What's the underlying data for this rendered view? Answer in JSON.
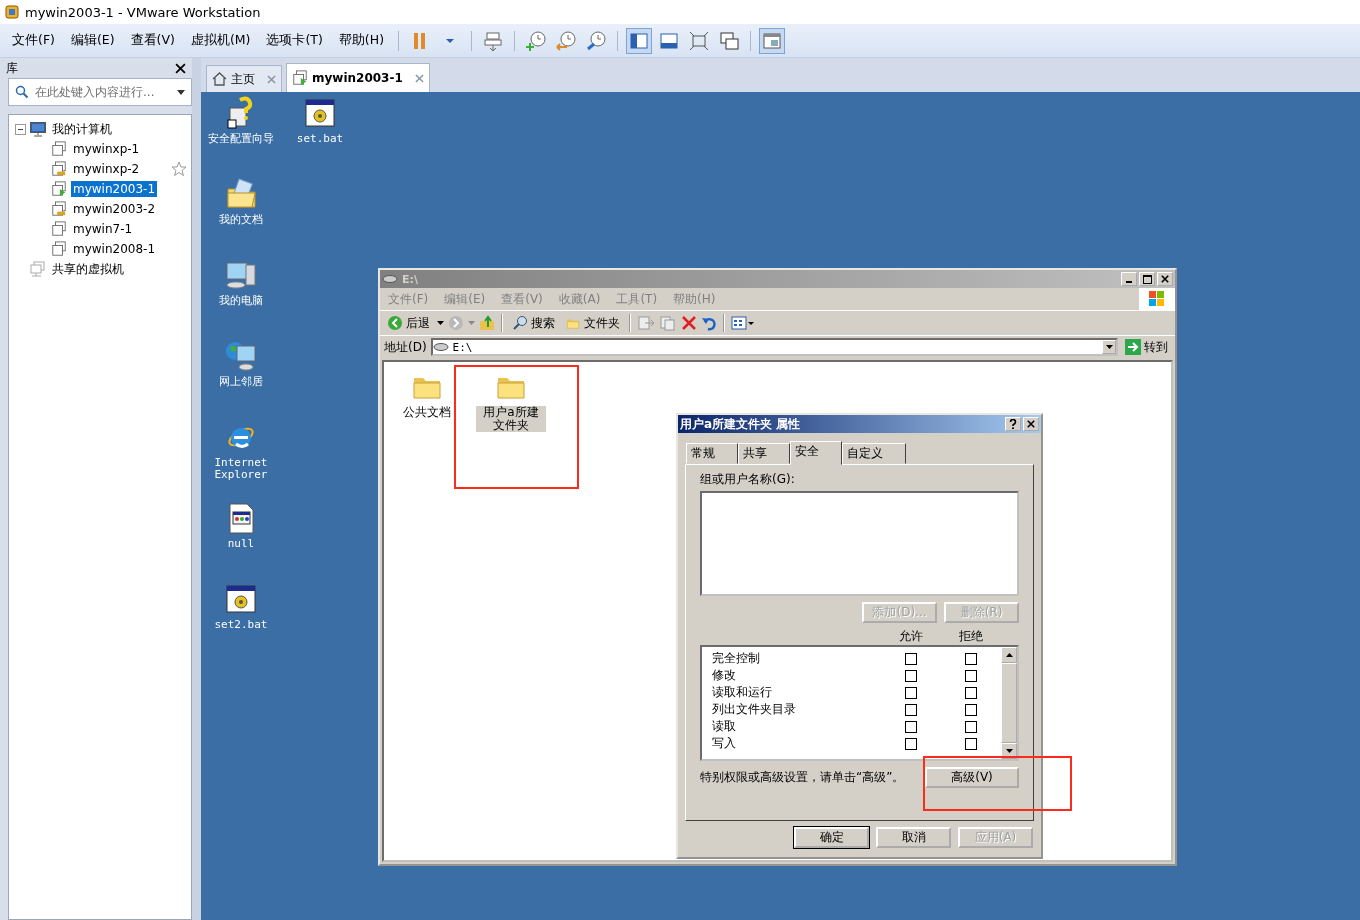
{
  "window": {
    "title": "mywin2003-1 - VMware Workstation"
  },
  "menu": [
    "文件(F)",
    "编辑(E)",
    "查看(V)",
    "虚拟机(M)",
    "选项卡(T)",
    "帮助(H)"
  ],
  "library": {
    "title": "库",
    "search": {
      "placeholder": "在此处键入内容进行..."
    },
    "tree": [
      {
        "label": "我的计算机",
        "kind": "computer",
        "expanded": true,
        "children": [
          {
            "label": "mywinxp-1",
            "kind": "off",
            "selected": false,
            "hovered": false
          },
          {
            "label": "mywinxp-2",
            "kind": "suspended",
            "selected": false,
            "hovered": true
          },
          {
            "label": "mywin2003-1",
            "kind": "running",
            "selected": true,
            "hovered": false
          },
          {
            "label": "mywin2003-2",
            "kind": "suspended",
            "selected": false,
            "hovered": false
          },
          {
            "label": "mywin7-1",
            "kind": "off",
            "selected": false,
            "hovered": false
          },
          {
            "label": "mywin2008-1",
            "kind": "off",
            "selected": false,
            "hovered": false
          }
        ]
      },
      {
        "label": "共享的虚拟机",
        "kind": "shared",
        "expanded": false
      }
    ]
  },
  "tabs": [
    {
      "label": "主页",
      "kind": "home",
      "selected": false
    },
    {
      "label": "mywin2003-1",
      "kind": "vm",
      "selected": true
    }
  ],
  "desktop": {
    "icons": [
      {
        "label": "安全配置向导",
        "kind": "wizard"
      },
      {
        "label": "set.bat",
        "kind": "batch"
      },
      {
        "label": "我的文档",
        "kind": "documents"
      },
      {
        "label": "我的电脑",
        "kind": "computer"
      },
      {
        "label": "网上邻居",
        "kind": "network"
      },
      {
        "label": "Internet Explorer",
        "kind": "browser"
      },
      {
        "label": "null",
        "kind": "file"
      },
      {
        "label": "set2.bat",
        "kind": "batch"
      }
    ]
  },
  "explorer": {
    "title": "E:\\",
    "menu": [
      "文件(F)",
      "编辑(E)",
      "查看(V)",
      "收藏(A)",
      "工具(T)",
      "帮助(H)"
    ],
    "toolbar": {
      "back": "后退",
      "search": "搜索",
      "folders": "文件夹"
    },
    "address": {
      "label": "地址(D)",
      "value": "E:\\",
      "go": "转到"
    },
    "items": [
      {
        "label": "公共文档",
        "selected": false
      },
      {
        "label": "用户a所建文件夹",
        "selected": true
      }
    ]
  },
  "dialog": {
    "title": "用户a所建文件夹 属性",
    "tabs": [
      {
        "label": "常规",
        "selected": false
      },
      {
        "label": "共享",
        "selected": false
      },
      {
        "label": "安全",
        "selected": true
      },
      {
        "label": "自定义",
        "selected": false
      }
    ],
    "group_label": "组或用户名称(G):",
    "list_buttons": [
      {
        "label": "添加(D)...",
        "disabled": true
      },
      {
        "label": "删除(R)",
        "disabled": true
      }
    ],
    "columns": [
      "允许",
      "拒绝"
    ],
    "permissions": [
      {
        "name": "完全控制",
        "allow": false,
        "deny": false
      },
      {
        "name": "修改",
        "allow": false,
        "deny": false
      },
      {
        "name": "读取和运行",
        "allow": false,
        "deny": false
      },
      {
        "name": "列出文件夹目录",
        "allow": false,
        "deny": false
      },
      {
        "name": "读取",
        "allow": false,
        "deny": false
      },
      {
        "name": "写入",
        "allow": false,
        "deny": false
      }
    ],
    "note": "特别权限或高级设置，请单击“高级”。",
    "advanced": "高级(V)",
    "buttons": [
      {
        "label": "确定",
        "disabled": false,
        "default": true
      },
      {
        "label": "取消",
        "disabled": false,
        "default": false
      },
      {
        "label": "应用(A)",
        "disabled": true,
        "default": false
      }
    ]
  }
}
